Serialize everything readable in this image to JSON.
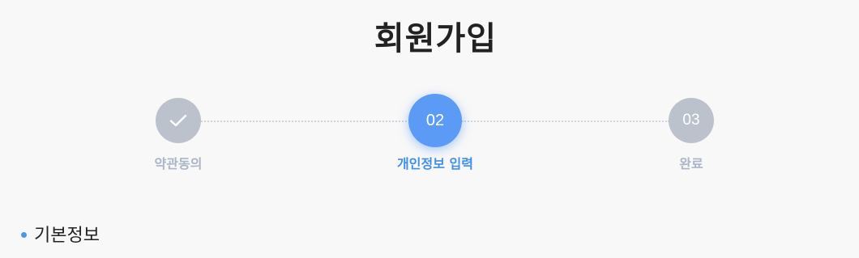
{
  "page": {
    "title": "회원가입"
  },
  "stepper": {
    "steps": [
      {
        "number": "",
        "label": "약관동의",
        "state": "completed",
        "icon": "check-icon"
      },
      {
        "number": "02",
        "label": "개인정보 입력",
        "state": "active"
      },
      {
        "number": "03",
        "label": "완료",
        "state": "pending"
      }
    ]
  },
  "section": {
    "title": "기본정보"
  },
  "colors": {
    "background": "#f8f8f8",
    "active_step": "#5b9bf6",
    "active_label": "#3f8fe8",
    "inactive_step": "#bcc2cc",
    "inactive_label": "#aab6c8",
    "section_bullet": "#4a98e6"
  }
}
